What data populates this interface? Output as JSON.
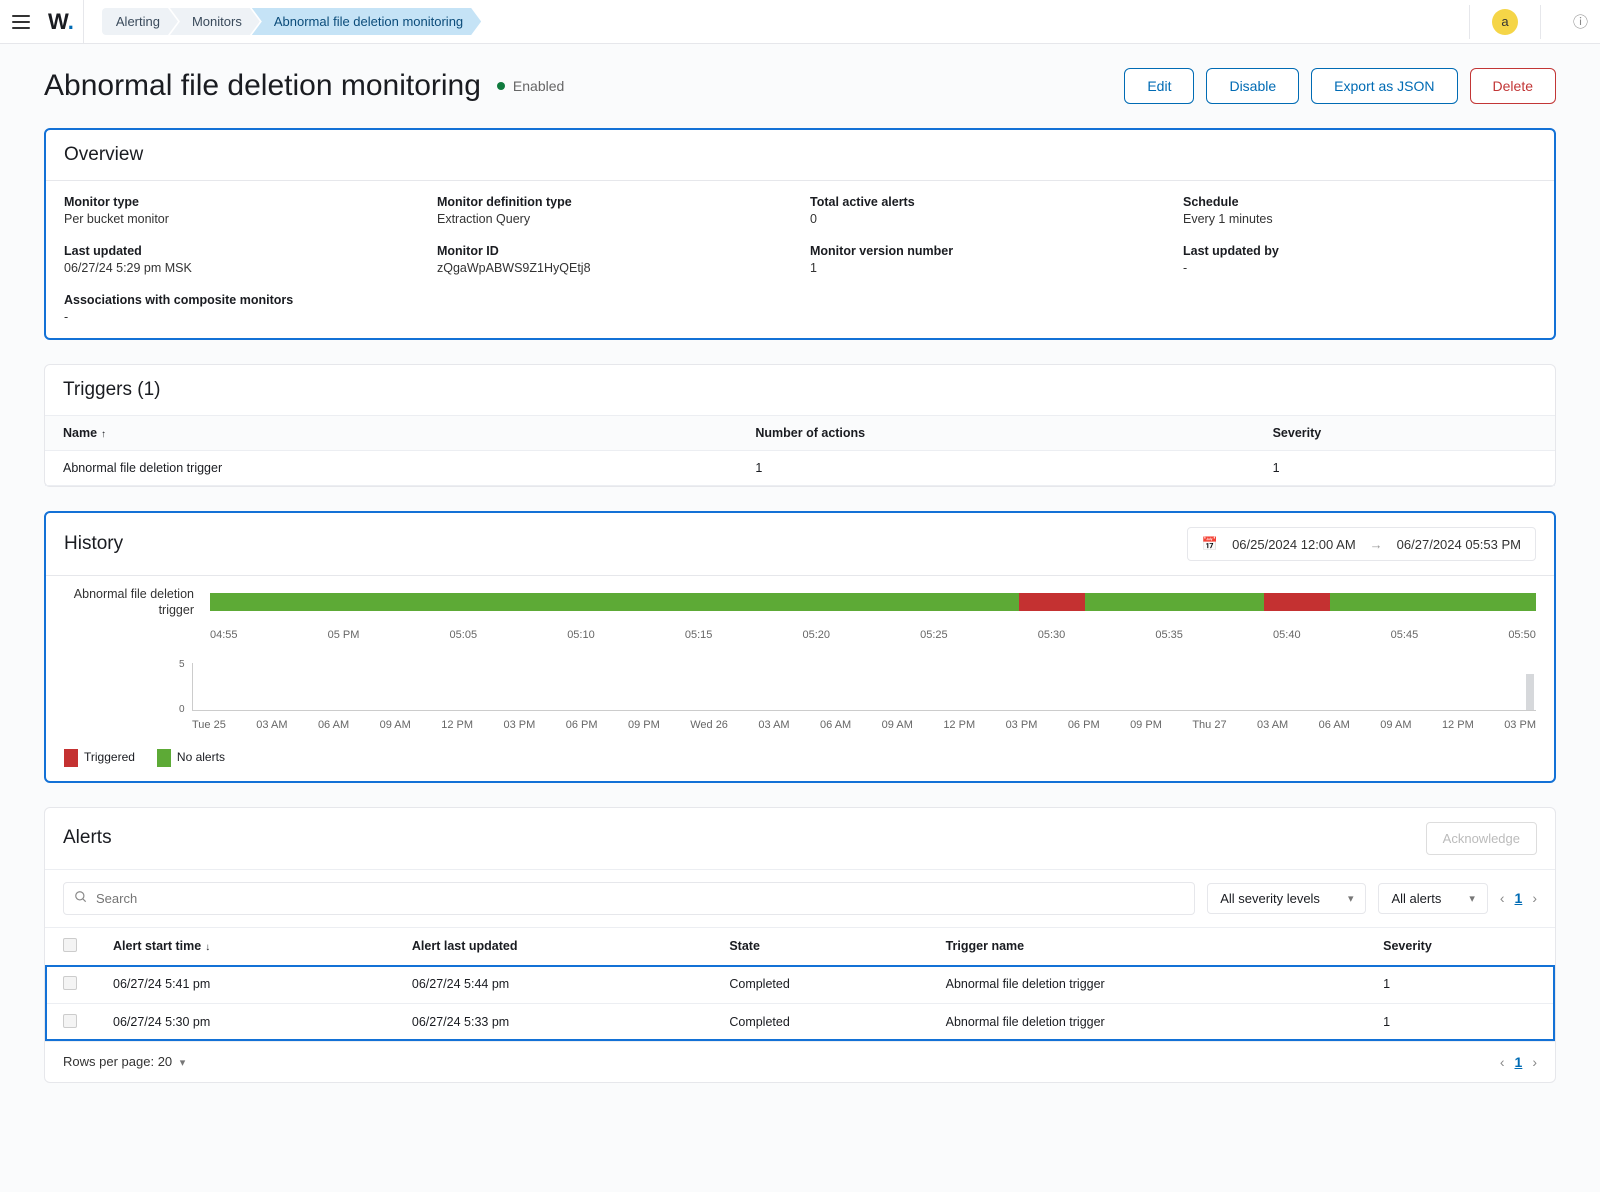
{
  "topbar": {
    "logo_text": "W",
    "help_glyph": "?"
  },
  "breadcrumbs": [
    "Alerting",
    "Monitors",
    "Abnormal file deletion monitoring"
  ],
  "page_title": "Abnormal file deletion monitoring",
  "status_label": "Enabled",
  "actions": {
    "edit": "Edit",
    "disable": "Disable",
    "export": "Export as JSON",
    "delete": "Delete"
  },
  "avatar_initial": "a",
  "overview": {
    "title": "Overview",
    "items": {
      "monitor_type": {
        "label": "Monitor type",
        "value": "Per bucket monitor"
      },
      "definition_type": {
        "label": "Monitor definition type",
        "value": "Extraction Query"
      },
      "total_active_alerts": {
        "label": "Total active alerts",
        "value": "0"
      },
      "schedule": {
        "label": "Schedule",
        "value": "Every 1 minutes"
      },
      "last_updated": {
        "label": "Last updated",
        "value": "06/27/24 5:29 pm MSK"
      },
      "monitor_id": {
        "label": "Monitor ID",
        "value": "zQgaWpABWS9Z1HyQEtj8"
      },
      "monitor_version": {
        "label": "Monitor version number",
        "value": "1"
      },
      "last_updated_by": {
        "label": "Last updated by",
        "value": "-"
      },
      "associations": {
        "label": "Associations with composite monitors",
        "value": "-"
      }
    }
  },
  "triggers": {
    "title": "Triggers (1)",
    "columns": {
      "name": "Name",
      "actions": "Number of actions",
      "severity": "Severity"
    },
    "rows": [
      {
        "name": "Abnormal file deletion trigger",
        "actions": "1",
        "severity": "1"
      }
    ]
  },
  "history": {
    "title": "History",
    "range_from": "06/25/2024 12:00 AM",
    "range_to": "06/27/2024 05:53 PM",
    "timeline_label": "Abnormal file deletion trigger",
    "time_ticks": [
      "04:55",
      "05 PM",
      "05:05",
      "05:10",
      "05:15",
      "05:20",
      "05:25",
      "05:30",
      "05:35",
      "05:40",
      "05:45",
      "05:50"
    ],
    "y_ticks": {
      "top": "5",
      "bottom": "0"
    },
    "day_ticks": [
      "Tue 25",
      "03 AM",
      "06 AM",
      "09 AM",
      "12 PM",
      "03 PM",
      "06 PM",
      "09 PM",
      "Wed 26",
      "03 AM",
      "06 AM",
      "09 AM",
      "12 PM",
      "03 PM",
      "06 PM",
      "09 PM",
      "Thu 27",
      "03 AM",
      "06 AM",
      "09 AM",
      "12 PM",
      "03 PM"
    ],
    "legend": {
      "triggered": "Triggered",
      "no_alerts": "No alerts"
    }
  },
  "chart_data": {
    "type": "bar",
    "timeline": {
      "domain_minutes": [
        "04:55",
        "05:53"
      ],
      "segments": [
        {
          "state": "no_alerts",
          "from": "04:55",
          "to": "05:30"
        },
        {
          "state": "triggered",
          "from": "05:30",
          "to": "05:33"
        },
        {
          "state": "no_alerts",
          "from": "05:33",
          "to": "05:41"
        },
        {
          "state": "triggered",
          "from": "05:41",
          "to": "05:44"
        },
        {
          "state": "no_alerts",
          "from": "05:44",
          "to": "05:53"
        }
      ],
      "colors": {
        "triggered": "#c43131",
        "no_alerts": "#5daa36"
      }
    },
    "overview_series": {
      "x_domain": [
        "2024-06-25 00:00",
        "2024-06-27 17:53"
      ],
      "ylim": [
        0,
        5
      ],
      "points": [
        {
          "x": "2024-06-27 17:50",
          "y": 4
        }
      ]
    }
  },
  "alerts": {
    "title": "Alerts",
    "acknowledge": "Acknowledge",
    "search_placeholder": "Search",
    "filters": {
      "severity": "All severity levels",
      "state": "All alerts"
    },
    "columns": {
      "start": "Alert start time",
      "updated": "Alert last updated",
      "state": "State",
      "trigger": "Trigger name",
      "severity": "Severity"
    },
    "rows": [
      {
        "start": "06/27/24 5:41 pm",
        "updated": "06/27/24 5:44 pm",
        "state": "Completed",
        "trigger": "Abnormal file deletion trigger",
        "severity": "1"
      },
      {
        "start": "06/27/24 5:30 pm",
        "updated": "06/27/24 5:33 pm",
        "state": "Completed",
        "trigger": "Abnormal file deletion trigger",
        "severity": "1"
      }
    ],
    "rows_per_page_label": "Rows per page:",
    "rows_per_page_value": "20",
    "page_current": "1"
  }
}
